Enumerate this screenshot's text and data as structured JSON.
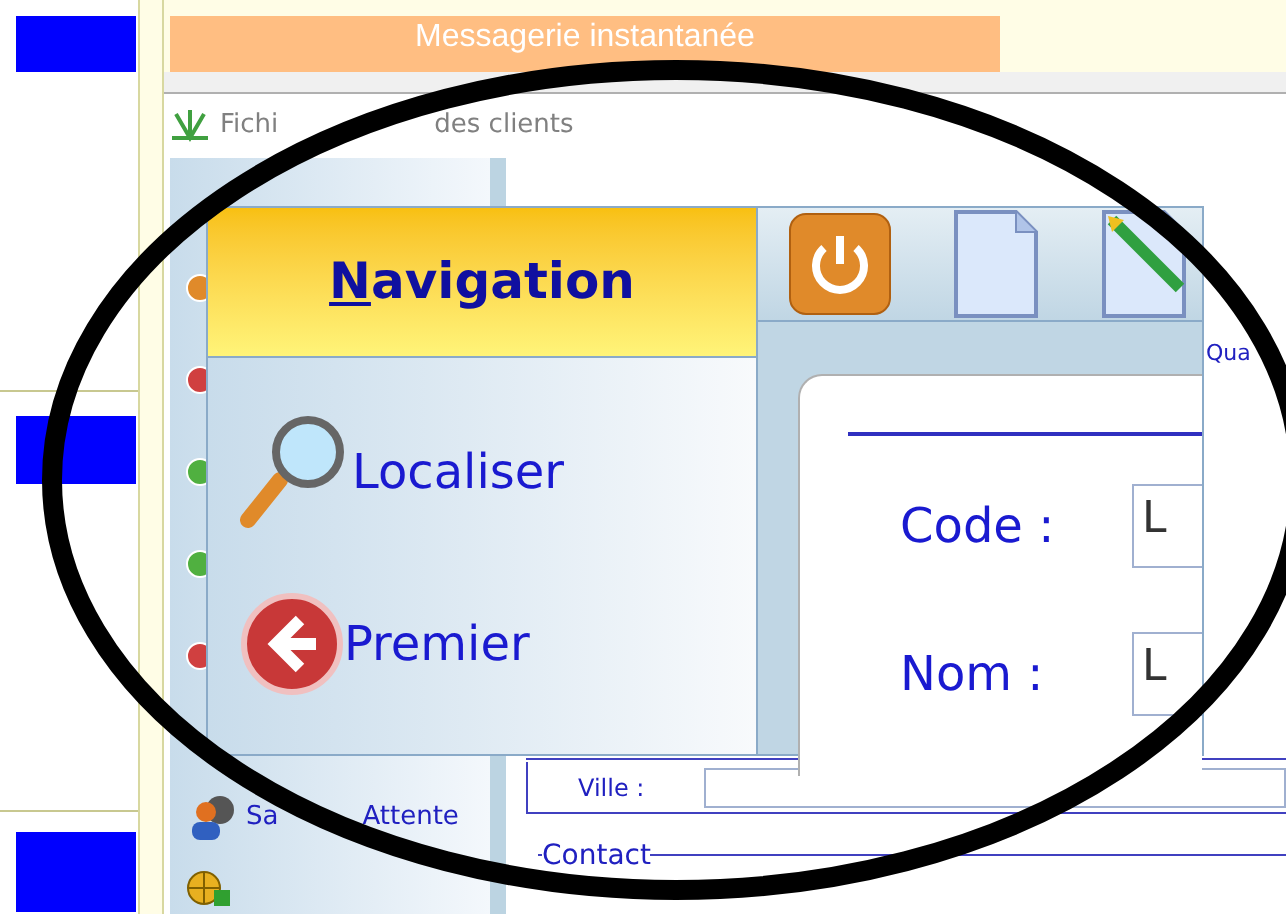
{
  "banner": {
    "title": "Messagerie instantanée"
  },
  "window": {
    "title_parts": [
      "Fichi",
      "des clients"
    ]
  },
  "side_nav": {
    "items": [
      {
        "kind": "dot",
        "color": "#e08a2a"
      },
      {
        "kind": "dot",
        "color": "#d04040"
      },
      {
        "kind": "dot",
        "color": "#50b040"
      },
      {
        "kind": "dot",
        "color": "#50b040"
      },
      {
        "kind": "dot",
        "color": "#d04040"
      },
      {
        "kind": "link",
        "label_parts": [
          "Sa",
          "Attente"
        ]
      },
      {
        "kind": "globe"
      }
    ]
  },
  "form": {
    "top_label": "Qua",
    "city_label": "Ville :",
    "contact_group": "Contact"
  },
  "magnifier": {
    "header": {
      "label": "Navigation",
      "first_letter_underlined": true
    },
    "items": [
      {
        "kind": "search",
        "label": "Localiser"
      },
      {
        "kind": "first",
        "label": "Premier"
      }
    ],
    "toolbar": [
      {
        "kind": "power"
      },
      {
        "kind": "new"
      },
      {
        "kind": "edit"
      }
    ],
    "fields": [
      {
        "label": "Code :",
        "value": "L"
      },
      {
        "label": "Nom :",
        "value": "L"
      }
    ]
  }
}
